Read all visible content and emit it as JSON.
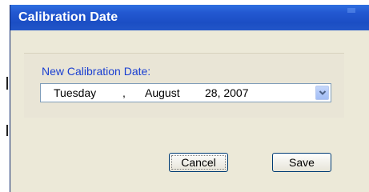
{
  "window": {
    "title": "Calibration Date"
  },
  "form": {
    "field_label": "New Calibration Date:",
    "date": {
      "weekday": "Tuesday",
      "separator": ",",
      "month": "August",
      "day_year": "28, 2007"
    },
    "dropdown_icon": "chevron-down-icon"
  },
  "buttons": {
    "cancel_label": "Cancel",
    "save_label": "Save"
  },
  "colors": {
    "titlebar": "#2358d1",
    "title_text": "#ffffff",
    "label_text": "#1a3fd1",
    "dialog_bg": "#ece9d8",
    "button_border": "#003c74"
  }
}
